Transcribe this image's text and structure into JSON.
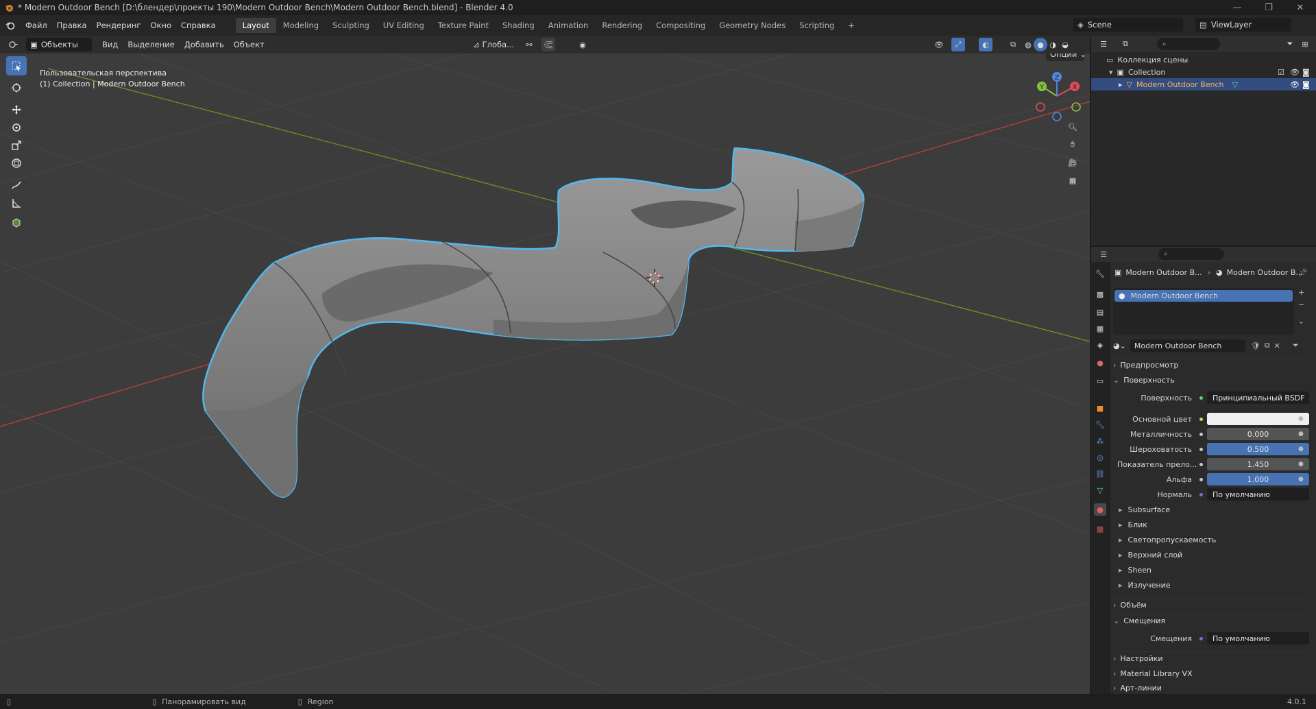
{
  "window": {
    "title": "* Modern Outdoor Bench [D:\\блендер\\проекты 190\\Modern Outdoor Bench\\Modern Outdoor Bench.blend] - Blender 4.0"
  },
  "menu": [
    "Файл",
    "Правка",
    "Рендеринг",
    "Окно",
    "Справка"
  ],
  "workspaces": [
    "Layout",
    "Modeling",
    "Sculpting",
    "UV Editing",
    "Texture Paint",
    "Shading",
    "Animation",
    "Rendering",
    "Compositing",
    "Geometry Nodes",
    "Scripting"
  ],
  "active_workspace": "Layout",
  "scene": {
    "name": "Scene",
    "view_layer": "ViewLayer"
  },
  "viewport_header": {
    "mode": "Объекты",
    "menus": [
      "Вид",
      "Выделение",
      "Добавить",
      "Объект"
    ],
    "transform_orientation": "Глоба...",
    "options_label": "Опции"
  },
  "viewport": {
    "perspective": "Пользовательская перспектива",
    "context": "(1) Collection | Modern Outdoor Bench",
    "gizmo_axes": [
      "X",
      "Y",
      "Z"
    ],
    "colors": {
      "bg": "#3c3c3c",
      "grid": "#464646",
      "x_axis": "#b3403f",
      "y_axis": "#6e8e28",
      "selection": "#52b8f0",
      "mesh": "#8a8a8a"
    }
  },
  "outliner": {
    "root": "Коллекция сцены",
    "collection": "Collection",
    "object": "Modern Outdoor Bench"
  },
  "properties": {
    "breadcrumb": [
      "Modern Outdoor B...",
      "Modern Outdoor B..."
    ],
    "material_slot": "Modern Outdoor Bench",
    "material_name": "Modern Outdoor Bench",
    "panels": {
      "preview": "Предпросмотр",
      "surface": "Поверхность",
      "volume": "Объём",
      "displacement": "Смещения",
      "settings": "Настройки",
      "material_library": "Material Library VX",
      "lineart": "Арт-линии"
    },
    "surface_rows": [
      {
        "label": "Поверхность",
        "value": "Принципиальный BSDF",
        "style": "dark"
      },
      {
        "label": "Основной цвет",
        "value": "",
        "style": "white"
      },
      {
        "label": "Металличность",
        "value": "0.000",
        "style": "grey"
      },
      {
        "label": "Шероховатость",
        "value": "0.500",
        "style": "blue"
      },
      {
        "label": "Показатель прело...",
        "value": "1.450",
        "style": "grey"
      },
      {
        "label": "Альфа",
        "value": "1.000",
        "style": "blue"
      },
      {
        "label": "Нормаль",
        "value": "По умолчанию",
        "style": "dark"
      }
    ],
    "subpanels": [
      "Subsurface",
      "Блик",
      "Светопропускаемость",
      "Верхний слой",
      "Sheen",
      "Излучение"
    ],
    "displacement_row": {
      "label": "Смещения",
      "value": "По умолчанию"
    }
  },
  "statusbar": {
    "hint1": "Панорамировать вид",
    "hint2": "Region",
    "version": "4.0.1"
  }
}
